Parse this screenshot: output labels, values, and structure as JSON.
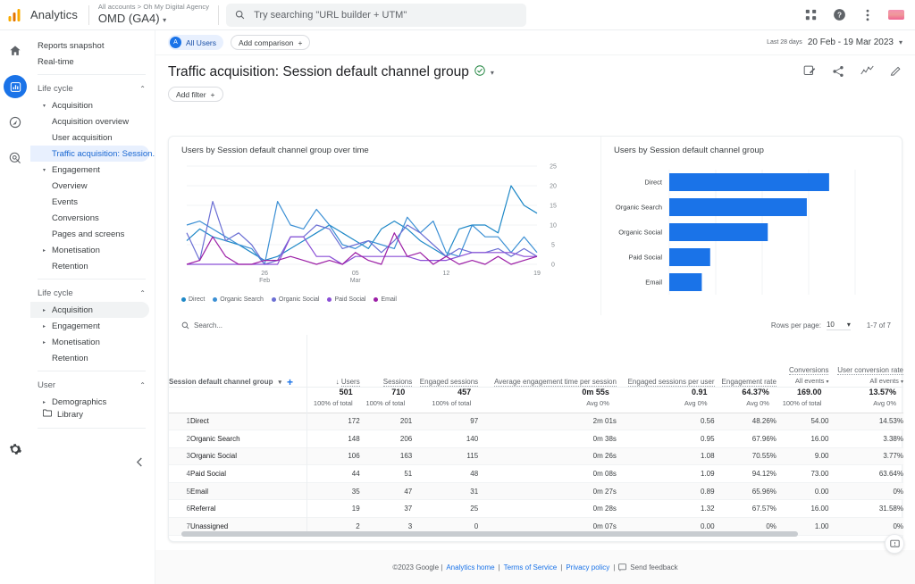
{
  "topbar": {
    "brand": "Analytics",
    "account_breadcrumb": "All accounts > Oh My Digital Agency",
    "property_name": "OMD (GA4)",
    "property_caret": "▾",
    "search_placeholder": "Try searching \"URL builder + UTM\"",
    "icons": [
      "apps-grid-icon",
      "help-circle-icon",
      "more-vertical-icon",
      "avatar"
    ]
  },
  "rail": {
    "items": [
      {
        "name": "home-icon",
        "label": "Home",
        "active": false
      },
      {
        "name": "reports-bar-chart-icon",
        "label": "Reports",
        "active": true
      },
      {
        "name": "explore-compass-icon",
        "label": "Explore",
        "active": false
      },
      {
        "name": "advertising-target-icon",
        "label": "Advertising",
        "active": false
      }
    ],
    "settings_label": "Admin"
  },
  "sidebar": {
    "top_items": [
      {
        "label": "Reports snapshot",
        "level": 0,
        "active": false,
        "triangle": ""
      },
      {
        "label": "Real-time",
        "level": 0,
        "active": false,
        "triangle": ""
      }
    ],
    "section_1_label": "Life cycle",
    "section_1_chevron": "⌃",
    "items_1": [
      {
        "label": "Acquisition",
        "level": 1,
        "active": false,
        "triangle": "▾"
      },
      {
        "label": "Acquisition overview",
        "level": 2,
        "active": false,
        "triangle": ""
      },
      {
        "label": "User acquisition",
        "level": 2,
        "active": false,
        "triangle": ""
      },
      {
        "label": "Traffic acquisition: Session...",
        "level": 2,
        "active": true,
        "triangle": ""
      },
      {
        "label": "Engagement",
        "level": 1,
        "active": false,
        "triangle": "▾"
      },
      {
        "label": "Overview",
        "level": 2,
        "active": false,
        "triangle": ""
      },
      {
        "label": "Events",
        "level": 2,
        "active": false,
        "triangle": ""
      },
      {
        "label": "Conversions",
        "level": 2,
        "active": false,
        "triangle": ""
      },
      {
        "label": "Pages and screens",
        "level": 2,
        "active": false,
        "triangle": ""
      },
      {
        "label": "Monetisation",
        "level": 1,
        "active": false,
        "triangle": "▸"
      },
      {
        "label": "Retention",
        "level": 2,
        "active": false,
        "triangle": ""
      }
    ],
    "section_2_label": "Life cycle",
    "section_2_chevron": "⌃",
    "items_2": [
      {
        "label": "Acquisition",
        "level": 1,
        "active": false,
        "hover": true,
        "triangle": "▸"
      },
      {
        "label": "Engagement",
        "level": 1,
        "active": false,
        "hover": false,
        "triangle": "▸"
      },
      {
        "label": "Monetisation",
        "level": 1,
        "active": false,
        "hover": false,
        "triangle": "▸"
      },
      {
        "label": "Retention",
        "level": 2,
        "active": false,
        "hover": false,
        "triangle": ""
      }
    ],
    "section_3_label": "User",
    "section_3_chevron": "⌃",
    "items_3": [
      {
        "label": "Demographics",
        "level": 1,
        "active": false,
        "triangle": "▸"
      }
    ],
    "library_label": "Library",
    "collapse_icon": "chevron-left-icon"
  },
  "toolbar": {
    "all_users_chip": "All Users",
    "all_users_initial": "A",
    "add_comparison": "Add comparison",
    "add_comparison_plus": "+",
    "date_label": "Last 28 days",
    "date_value": "20 Feb - 19 Mar 2023",
    "date_caret": "▾",
    "page_title": "Traffic acquisition: Session default channel group",
    "title_caret": "▾",
    "add_filter": "Add filter",
    "add_filter_plus": "+",
    "tool_icons": [
      "insights-edit-icon",
      "share-icon",
      "compare-trend-icon",
      "edit-pencil-icon"
    ]
  },
  "chart_data": [
    {
      "type": "line",
      "title": "Users by Session default channel group over time",
      "xlabel": "",
      "ylabel": "",
      "ylim": [
        0,
        25
      ],
      "yticks": [
        0,
        5,
        10,
        15,
        20,
        25
      ],
      "xticks": [
        "26\nFeb",
        "05\nMar",
        "12",
        "19"
      ],
      "xtick_labels": [
        {
          "top": "26",
          "bottom": "Feb"
        },
        {
          "top": "05",
          "bottom": "Mar"
        },
        {
          "top": "12",
          "bottom": ""
        },
        {
          "top": "19",
          "bottom": ""
        }
      ],
      "grid": true,
      "legend_position": "bottom",
      "x": [
        "20 Feb",
        "21 Feb",
        "22 Feb",
        "23 Feb",
        "24 Feb",
        "25 Feb",
        "26 Feb",
        "27 Feb",
        "28 Feb",
        "01 Mar",
        "02 Mar",
        "03 Mar",
        "04 Mar",
        "05 Mar",
        "06 Mar",
        "07 Mar",
        "08 Mar",
        "09 Mar",
        "10 Mar",
        "11 Mar",
        "12 Mar",
        "13 Mar",
        "14 Mar",
        "15 Mar",
        "16 Mar",
        "17 Mar",
        "18 Mar",
        "19 Mar"
      ],
      "series": [
        {
          "name": "Direct",
          "color": "#1e88c7",
          "values": [
            6,
            9,
            7,
            6,
            5,
            3,
            1,
            2,
            4,
            6,
            8,
            10,
            8,
            6,
            4,
            9,
            11,
            9,
            6,
            4,
            2,
            9,
            10,
            10,
            8,
            20,
            15,
            13
          ]
        },
        {
          "name": "Organic Search",
          "color": "#3b8fd4",
          "values": [
            10,
            11,
            9,
            7,
            5,
            4,
            0,
            16,
            10,
            9,
            14,
            10,
            5,
            4,
            6,
            5,
            4,
            12,
            8,
            11,
            3,
            2,
            10,
            7,
            7,
            3,
            7,
            3
          ]
        },
        {
          "name": "Organic Social",
          "color": "#6b6fd4",
          "values": [
            8,
            1,
            16,
            6,
            8,
            5,
            0,
            1,
            7,
            7,
            10,
            9,
            4,
            5,
            6,
            3,
            6,
            10,
            8,
            5,
            2,
            4,
            3,
            3,
            4,
            2,
            4,
            2
          ]
        },
        {
          "name": "Paid Social",
          "color": "#8a4fd6",
          "values": [
            0,
            0,
            0,
            0,
            0,
            0,
            0,
            0,
            7,
            7,
            2,
            2,
            0,
            2,
            2,
            2,
            2,
            2,
            1,
            1,
            1,
            2,
            3,
            3,
            3,
            3,
            2,
            2
          ]
        },
        {
          "name": "Email",
          "color": "#9c1fa6",
          "values": [
            0,
            1,
            7,
            2,
            0,
            0,
            1,
            1,
            2,
            1,
            0,
            1,
            0,
            3,
            1,
            0,
            8,
            2,
            3,
            0,
            2,
            0,
            1,
            0,
            2,
            0,
            1,
            2
          ]
        }
      ]
    },
    {
      "type": "bar",
      "orientation": "horizontal",
      "title": "Users by Session default channel group",
      "categories": [
        "Direct",
        "Organic Search",
        "Organic Social",
        "Paid Social",
        "Email"
      ],
      "values": [
        172,
        148,
        106,
        44,
        35
      ],
      "xlim": [
        0,
        200
      ],
      "xticks": [
        0,
        50,
        100,
        150,
        200
      ],
      "bar_color": "#1a73e8",
      "grid": true
    }
  ],
  "table": {
    "search_placeholder": "Search...",
    "rows_per_page_label": "Rows per page:",
    "rows_per_page_value": "10",
    "rows_per_page_caret": "▾",
    "range_label": "1-7 of 7",
    "dimension_header": "Session default channel group",
    "dimension_caret": "▾",
    "add_dimension_plus": "+",
    "columns": [
      {
        "label": "Users",
        "sort_arrow": "↓",
        "sub": ""
      },
      {
        "label": "Sessions",
        "sort_arrow": "",
        "sub": ""
      },
      {
        "label": "Engaged sessions",
        "sort_arrow": "",
        "sub": ""
      },
      {
        "label": "Average engagement time per session",
        "sort_arrow": "",
        "sub": ""
      },
      {
        "label": "Engaged sessions per user",
        "sort_arrow": "",
        "sub": ""
      },
      {
        "label": "Engagement rate",
        "sort_arrow": "",
        "sub": ""
      },
      {
        "label": "Conversions",
        "sort_arrow": "",
        "sub": "All events"
      },
      {
        "label": "User conversion rate",
        "sort_arrow": "",
        "sub": "All events"
      }
    ],
    "totals": [
      {
        "value": "501",
        "sub": "100% of total"
      },
      {
        "value": "710",
        "sub": "100% of total"
      },
      {
        "value": "457",
        "sub": "100% of total"
      },
      {
        "value": "0m 55s",
        "sub": "Avg 0%"
      },
      {
        "value": "0.91",
        "sub": "Avg 0%"
      },
      {
        "value": "64.37%",
        "sub": "Avg 0%"
      },
      {
        "value": "169.00",
        "sub": "100% of total"
      },
      {
        "value": "13.57%",
        "sub": "Avg 0%"
      }
    ],
    "rows": [
      {
        "idx": "1",
        "dim": "Direct",
        "cells": [
          "172",
          "201",
          "97",
          "2m 01s",
          "0.56",
          "48.26%",
          "54.00",
          "14.53%"
        ]
      },
      {
        "idx": "2",
        "dim": "Organic Search",
        "cells": [
          "148",
          "206",
          "140",
          "0m 38s",
          "0.95",
          "67.96%",
          "16.00",
          "3.38%"
        ]
      },
      {
        "idx": "3",
        "dim": "Organic Social",
        "cells": [
          "106",
          "163",
          "115",
          "0m 26s",
          "1.08",
          "70.55%",
          "9.00",
          "3.77%"
        ]
      },
      {
        "idx": "4",
        "dim": "Paid Social",
        "cells": [
          "44",
          "51",
          "48",
          "0m 08s",
          "1.09",
          "94.12%",
          "73.00",
          "63.64%"
        ]
      },
      {
        "idx": "5",
        "dim": "Email",
        "cells": [
          "35",
          "47",
          "31",
          "0m 27s",
          "0.89",
          "65.96%",
          "0.00",
          "0%"
        ]
      },
      {
        "idx": "6",
        "dim": "Referral",
        "cells": [
          "19",
          "37",
          "25",
          "0m 28s",
          "1.32",
          "67.57%",
          "16.00",
          "31.58%"
        ]
      },
      {
        "idx": "7",
        "dim": "Unassigned",
        "cells": [
          "2",
          "3",
          "0",
          "0m 07s",
          "0.00",
          "0%",
          "1.00",
          "0%"
        ]
      }
    ]
  },
  "footer": {
    "copyright": "©2023 Google |",
    "links": [
      "Analytics home",
      "Terms of Service",
      "Privacy policy"
    ],
    "sep": "|",
    "feedback": "Send feedback",
    "feedback_icon": "feedback-icon"
  },
  "colors": {
    "accent": "#1a73e8",
    "active_nav_bg": "#e8f0fe",
    "active_nav_text": "#1967d2",
    "bar": "#1a73e8",
    "check_green": "#188038"
  }
}
